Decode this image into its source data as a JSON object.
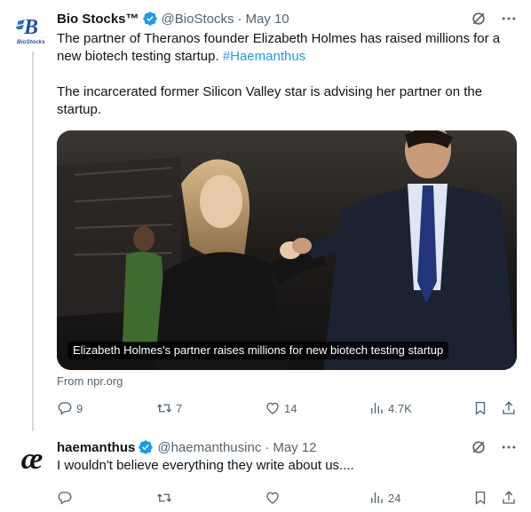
{
  "tweets": [
    {
      "display_name": "Bio Stocks™",
      "handle": "@BioStocks",
      "separator": "·",
      "date": "May 10",
      "avatar_text": "BioStocks",
      "avatar_letter": "B",
      "text_part1": "The partner of Theranos founder Elizabeth Holmes has raised millions for a new biotech testing startup. ",
      "hashtag": "#Haemanthus",
      "text_part2": "The incarcerated former Silicon Valley star is advising her partner on the startup.",
      "card": {
        "caption": "Elizabeth Holmes's partner raises millions for new biotech testing startup",
        "source": "From npr.org"
      },
      "stats": {
        "replies": "9",
        "retweets": "7",
        "likes": "14",
        "views": "4.7K"
      }
    },
    {
      "display_name": "haemanthus",
      "handle": "@haemanthusinc",
      "separator": "·",
      "date": "May 12",
      "avatar_letter": "æ",
      "text": "I wouldn't believe everything they write about us....",
      "stats": {
        "replies": "",
        "retweets": "",
        "likes": "",
        "views": "24"
      }
    }
  ],
  "colors": {
    "text": "#0f1419",
    "secondary": "#536471",
    "accent": "#1d9bf0",
    "border": "#cfd9de"
  },
  "icons": [
    "verified-badge-icon",
    "grok-icon",
    "more-icon",
    "reply-icon",
    "retweet-icon",
    "like-icon",
    "views-icon",
    "bookmark-icon",
    "share-icon"
  ]
}
